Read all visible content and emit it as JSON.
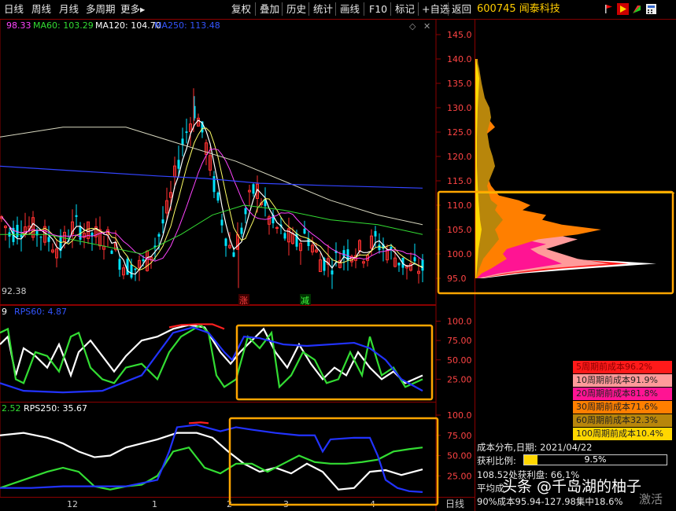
{
  "toolbar": {
    "left_tabs": [
      "日线",
      "周线",
      "月线",
      "多周期",
      "更多▸"
    ],
    "right_buttons": [
      "复权",
      "叠加",
      "历史",
      "统计",
      "画线",
      "F10",
      "标记",
      "+自选",
      "返回"
    ],
    "stock": "600745 闻泰科技"
  },
  "ma_legend": {
    "ma30": "98.33",
    "ma60": "MA60: 103.29",
    "ma120": "MA120: 104.70",
    "ma250": "MA250: 113.48"
  },
  "price_axis": [
    "145.0",
    "140.0",
    "135.0",
    "130.0",
    "125.0",
    "120.0",
    "115.0",
    "110.0",
    "105.0",
    "100.0",
    "95.0"
  ],
  "low_label": "92.38",
  "markers": {
    "zhang": "涨",
    "jian": "减"
  },
  "rps1": {
    "prefix": "9",
    "label": "RPS60: 4.87",
    "axis": [
      "100.0",
      "75.00",
      "50.00",
      "25.00"
    ]
  },
  "rps2": {
    "prefix": "2.52",
    "label": "RPS250: 35.67",
    "axis": [
      "100.0",
      "75.00",
      "50.00",
      "25.00"
    ]
  },
  "xaxis": {
    "m12": "12",
    "m1": "1",
    "m2": "2",
    "m3": "3",
    "m4": "4",
    "period": "日线"
  },
  "cost_legend": [
    {
      "text": "5周期前成本96.2%",
      "bg": "#ff1a1a",
      "fg": "#8b0000"
    },
    {
      "text": "10周期前成本91.9%",
      "bg": "#ff9a9a",
      "fg": "#222222"
    },
    {
      "text": "20周期前成本81.8%",
      "bg": "#ff1493",
      "fg": "#222222"
    },
    {
      "text": "30周期前成本71.6%",
      "bg": "#ff7f00",
      "fg": "#222222"
    },
    {
      "text": "60周期前成本32.3%",
      "bg": "#b8860b",
      "fg": "#222222"
    },
    {
      "text": "100周期前成本10.4%",
      "bg": "#ffd700",
      "fg": "#222222"
    }
  ],
  "cost_info": {
    "date_line": "成本分布,日期: 2021/04/22",
    "profit_label": "获利比例:",
    "profit_value": "9.5%",
    "profit_fraction": 0.095,
    "line2": "108.52处获利盘: 66.1%",
    "line3": "平均成",
    "line4": "90%成本95.94-127.98集中18.6%"
  },
  "watermark": {
    "main": "头条 @千岛湖的柚子",
    "corner": "激活"
  },
  "colors": {
    "frame": "#8b0000",
    "orange": "#ffa500",
    "up": "#ff3030",
    "down": "#00e5ff",
    "ma5": "#ffffff",
    "ma10": "#ffff66",
    "ma20": "#ff44ff",
    "ma60": "#33dd33",
    "ma120": "#d8d8c0",
    "ma250": "#3344ff"
  }
}
